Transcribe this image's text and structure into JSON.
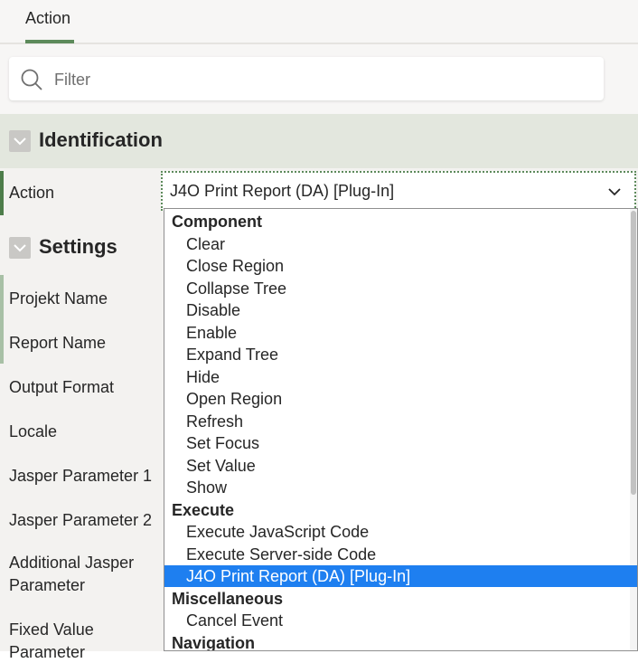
{
  "tabs": {
    "active_label": "Action"
  },
  "filter": {
    "placeholder": "Filter",
    "icon": "search-icon"
  },
  "sections": {
    "identification": {
      "title": "Identification"
    },
    "settings": {
      "title": "Settings"
    }
  },
  "properties": {
    "action_label": "Action",
    "action_value": "J4O Print Report (DA) [Plug-In]",
    "projekt_name": "Projekt Name",
    "report_name": "Report Name",
    "output_format": "Output Format",
    "locale": "Locale",
    "jasper_param_1": "Jasper Parameter 1",
    "jasper_param_2": "Jasper Parameter 2",
    "additional_jasper_1": "Additional Jasper",
    "additional_jasper_2": "Parameter",
    "fixed_value_1": "Fixed Value",
    "fixed_value_2": "Parameter"
  },
  "dropdown": {
    "items": [
      {
        "kind": "group",
        "label": "Component"
      },
      {
        "kind": "option",
        "label": "Clear"
      },
      {
        "kind": "option",
        "label": "Close Region"
      },
      {
        "kind": "option",
        "label": "Collapse Tree"
      },
      {
        "kind": "option",
        "label": "Disable"
      },
      {
        "kind": "option",
        "label": "Enable"
      },
      {
        "kind": "option",
        "label": "Expand Tree"
      },
      {
        "kind": "option",
        "label": "Hide"
      },
      {
        "kind": "option",
        "label": "Open Region"
      },
      {
        "kind": "option",
        "label": "Refresh"
      },
      {
        "kind": "option",
        "label": "Set Focus"
      },
      {
        "kind": "option",
        "label": "Set Value"
      },
      {
        "kind": "option",
        "label": "Show"
      },
      {
        "kind": "group",
        "label": "Execute"
      },
      {
        "kind": "option",
        "label": "Execute JavaScript Code"
      },
      {
        "kind": "option",
        "label": "Execute Server-side Code"
      },
      {
        "kind": "option",
        "label": "J4O Print Report (DA) [Plug-In]",
        "selected": true
      },
      {
        "kind": "group",
        "label": "Miscellaneous"
      },
      {
        "kind": "option",
        "label": "Cancel Event"
      },
      {
        "kind": "group",
        "label": "Navigation"
      }
    ]
  },
  "colors": {
    "accent": "#5d8a5b",
    "selection": "#1e7ff0",
    "section_bg": "#e3e7de"
  }
}
